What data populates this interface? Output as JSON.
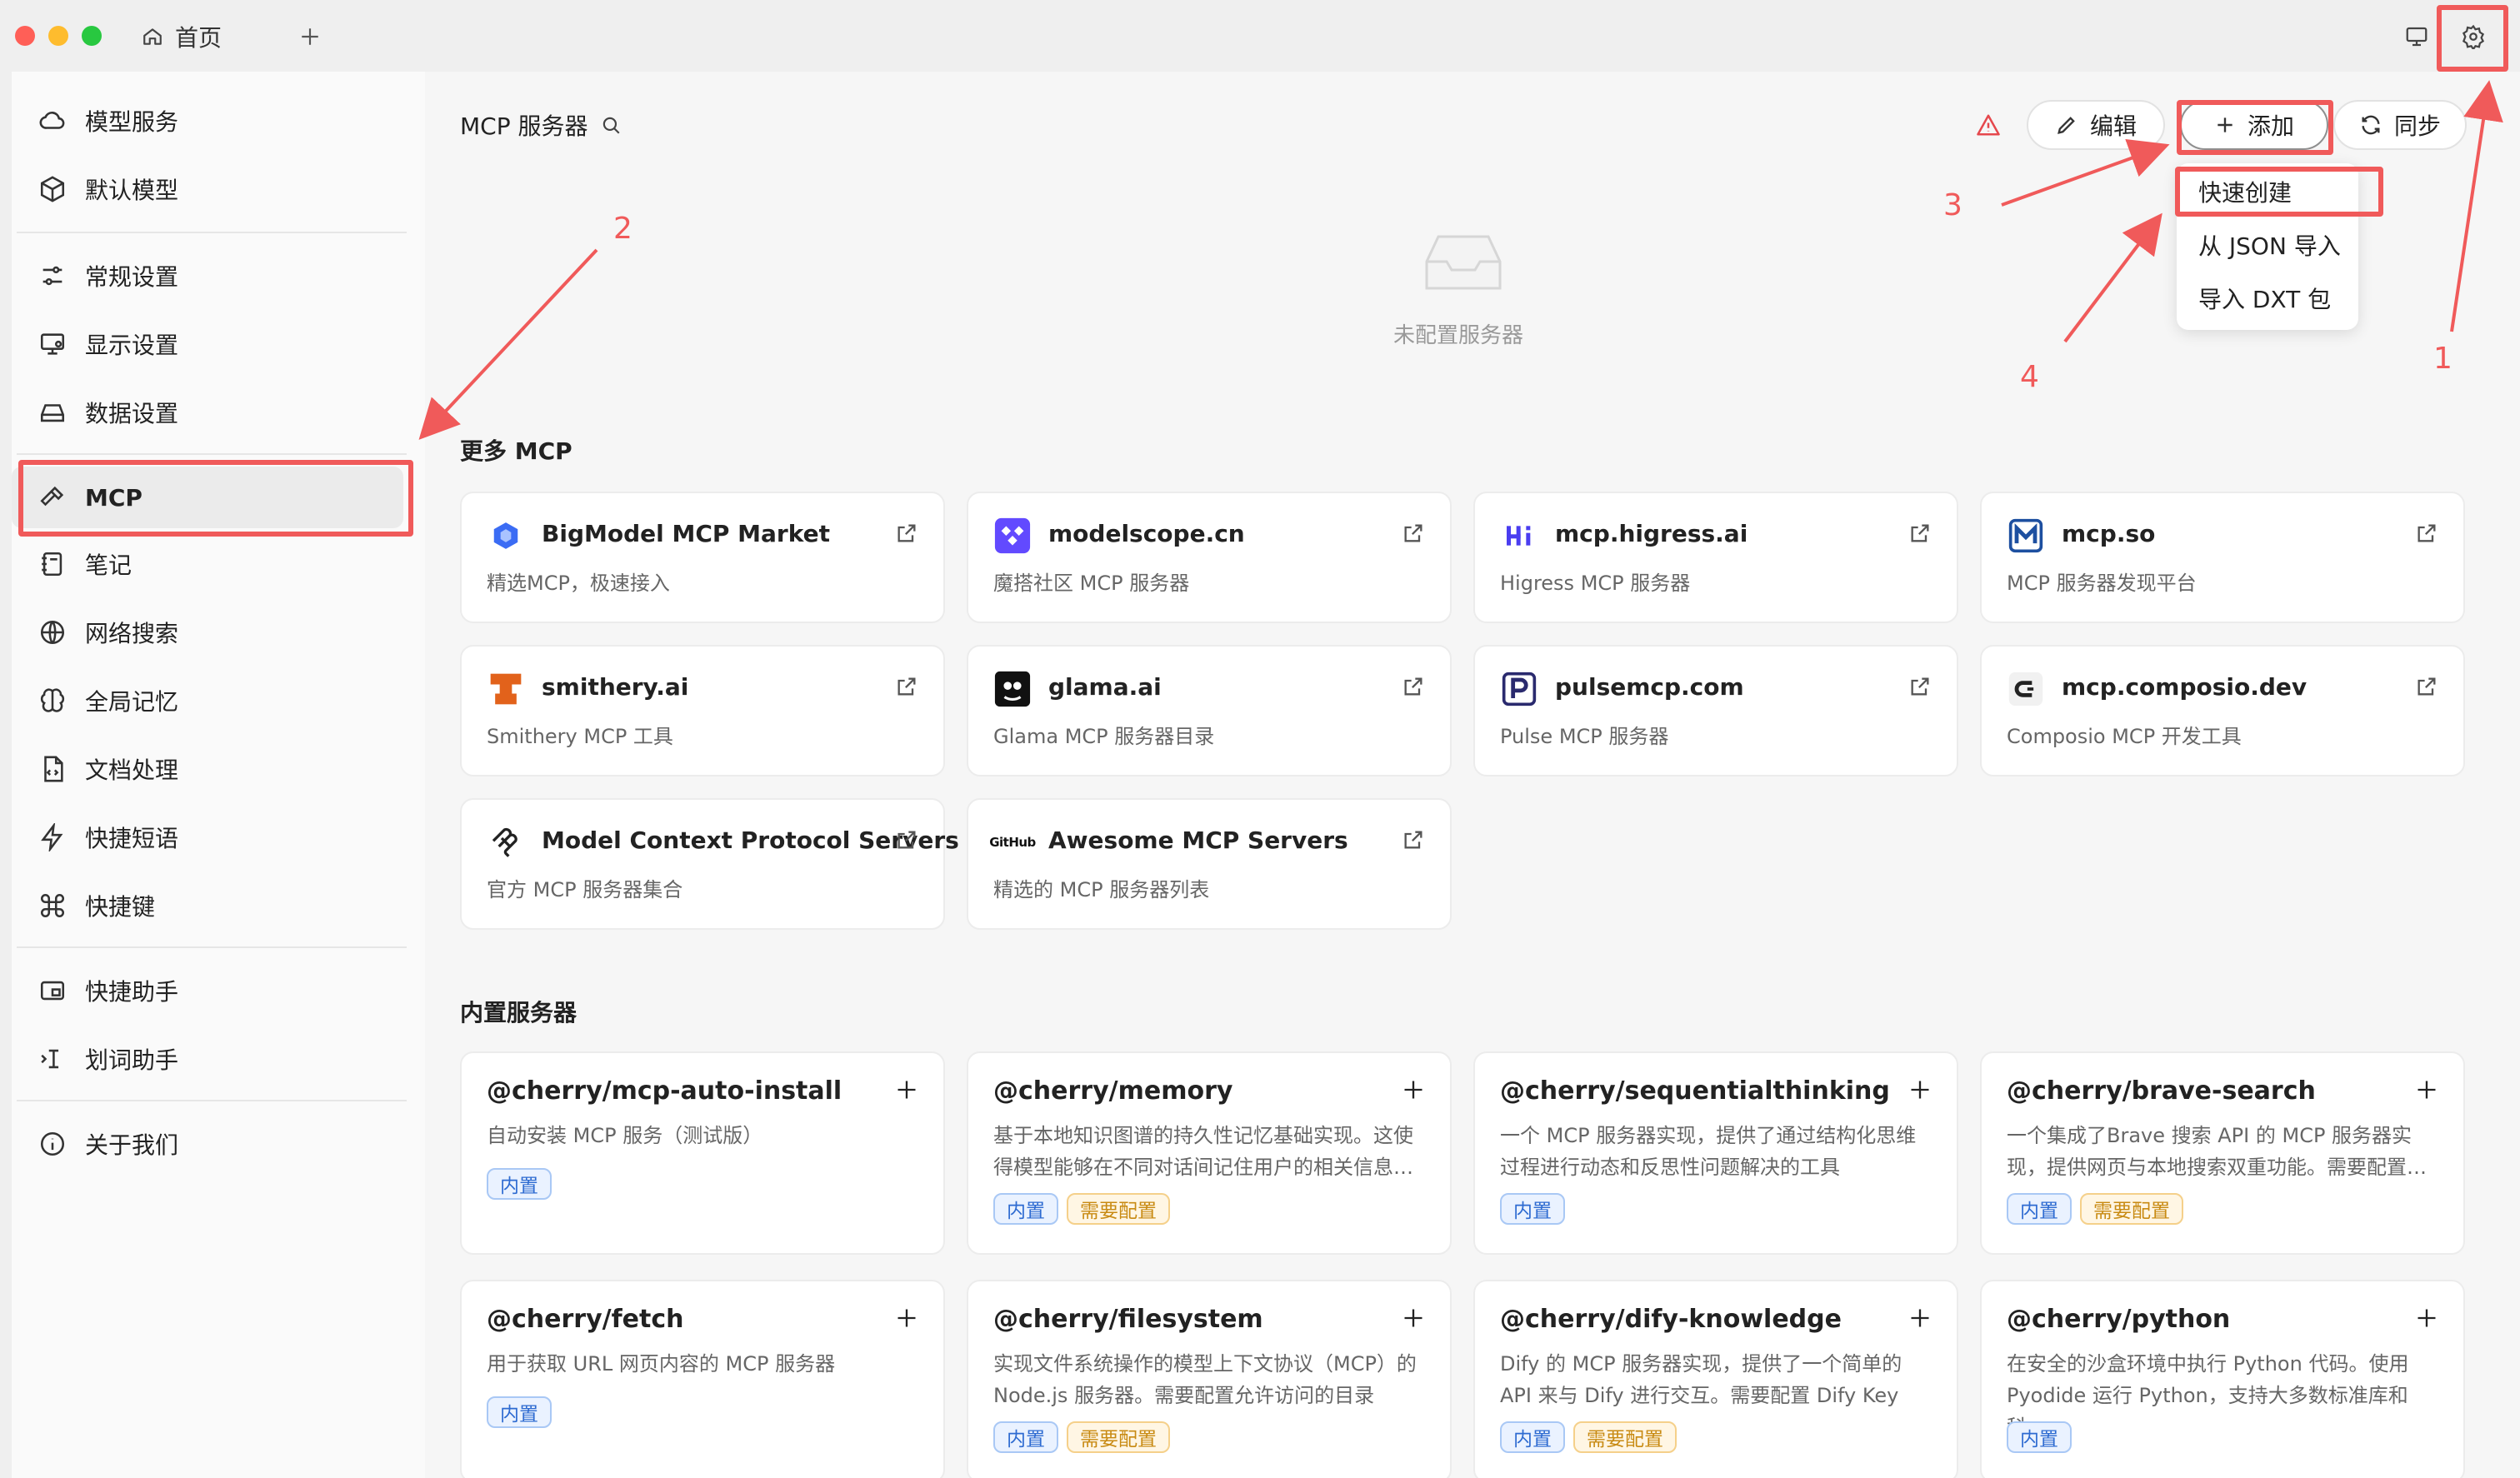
{
  "titlebar": {
    "home_tab": "首页",
    "colors": {
      "red": "#ff5f57",
      "yellow": "#febc2e",
      "green": "#28c840"
    }
  },
  "sidebar": {
    "items": [
      {
        "id": "model",
        "label": "模型服务",
        "icon": "cloud-icon"
      },
      {
        "id": "default-model",
        "label": "默认模型",
        "icon": "cube-icon"
      },
      {
        "id": "general",
        "label": "常规设置",
        "icon": "sliders-icon"
      },
      {
        "id": "display",
        "label": "显示设置",
        "icon": "monitor-gear-icon"
      },
      {
        "id": "data",
        "label": "数据设置",
        "icon": "hard-drive-icon"
      },
      {
        "id": "mcp",
        "label": "MCP",
        "icon": "hammer-icon"
      },
      {
        "id": "notes",
        "label": "笔记",
        "icon": "notebook-icon"
      },
      {
        "id": "web-search",
        "label": "网络搜索",
        "icon": "globe-icon"
      },
      {
        "id": "memory",
        "label": "全局记忆",
        "icon": "brain-icon"
      },
      {
        "id": "doc",
        "label": "文档处理",
        "icon": "file-code-icon"
      },
      {
        "id": "phrases",
        "label": "快捷短语",
        "icon": "zap-icon"
      },
      {
        "id": "shortcuts",
        "label": "快捷键",
        "icon": "command-icon"
      },
      {
        "id": "assistant",
        "label": "快捷助手",
        "icon": "app-window-icon"
      },
      {
        "id": "selection",
        "label": "划词助手",
        "icon": "text-cursor-icon"
      },
      {
        "id": "about",
        "label": "关于我们",
        "icon": "info-icon"
      }
    ]
  },
  "header": {
    "title": "MCP 服务器",
    "edit": "编辑",
    "add": "添加",
    "sync": "同步"
  },
  "dropdown": {
    "items": [
      "快速创建",
      "从 JSON 导入",
      "导入 DXT 包"
    ]
  },
  "empty": {
    "text": "未配置服务器"
  },
  "more_mcp": {
    "title": "更多 MCP",
    "cards": [
      {
        "name": "BigModel MCP Market",
        "desc": "精选MCP，极速接入",
        "icon": "bigmodel-icon"
      },
      {
        "name": "modelscope.cn",
        "desc": "魔搭社区 MCP 服务器",
        "icon": "modelscope-icon"
      },
      {
        "name": "mcp.higress.ai",
        "desc": "Higress MCP 服务器",
        "icon": "higress-icon"
      },
      {
        "name": "mcp.so",
        "desc": "MCP 服务器发现平台",
        "icon": "mcp-so-icon"
      },
      {
        "name": "smithery.ai",
        "desc": "Smithery MCP 工具",
        "icon": "smithery-icon"
      },
      {
        "name": "glama.ai",
        "desc": "Glama MCP 服务器目录",
        "icon": "glama-icon"
      },
      {
        "name": "pulsemcp.com",
        "desc": "Pulse MCP 服务器",
        "icon": "pulsemcp-icon"
      },
      {
        "name": "mcp.composio.dev",
        "desc": "Composio MCP 开发工具",
        "icon": "composio-icon"
      },
      {
        "name": "Model Context Protocol Servers",
        "desc": "官方 MCP 服务器集合",
        "icon": "mcp-protocol-icon"
      },
      {
        "name": "Awesome MCP Servers",
        "desc": "精选的 MCP 服务器列表",
        "icon": "github-icon"
      }
    ]
  },
  "builtin": {
    "title": "内置服务器",
    "tag_builtin": "内置",
    "tag_config": "需要配置",
    "servers": [
      {
        "name": "@cherry/mcp-auto-install",
        "desc": "自动安装 MCP 服务（测试版）",
        "config": false
      },
      {
        "name": "@cherry/memory",
        "desc": "基于本地知识图谱的持久性记忆基础实现。这使得模型能够在不同对话间记住用户的相关信息…",
        "config": true
      },
      {
        "name": "@cherry/sequentialthinking",
        "desc": "一个 MCP 服务器实现，提供了通过结构化思维过程进行动态和反思性问题解决的工具",
        "config": false
      },
      {
        "name": "@cherry/brave-search",
        "desc": "一个集成了Brave 搜索 API 的 MCP 服务器实现，提供网页与本地搜索双重功能。需要配置…",
        "config": true
      },
      {
        "name": "@cherry/fetch",
        "desc": "用于获取 URL 网页内容的 MCP 服务器",
        "config": false
      },
      {
        "name": "@cherry/filesystem",
        "desc": "实现文件系统操作的模型上下文协议（MCP）的 Node.js 服务器。需要配置允许访问的目录",
        "config": true
      },
      {
        "name": "@cherry/dify-knowledge",
        "desc": "Dify 的 MCP 服务器实现，提供了一个简单的 API 来与 Dify 进行交互。需要配置 Dify Key",
        "config": true
      },
      {
        "name": "@cherry/python",
        "desc": "在安全的沙盒环境中执行 Python 代码。使用 Pyodide 运行 Python，支持大多数标准库和科…",
        "config": false
      }
    ]
  },
  "annotations": {
    "labels": [
      "1",
      "2",
      "3",
      "4"
    ],
    "color": "#f05a5a"
  }
}
